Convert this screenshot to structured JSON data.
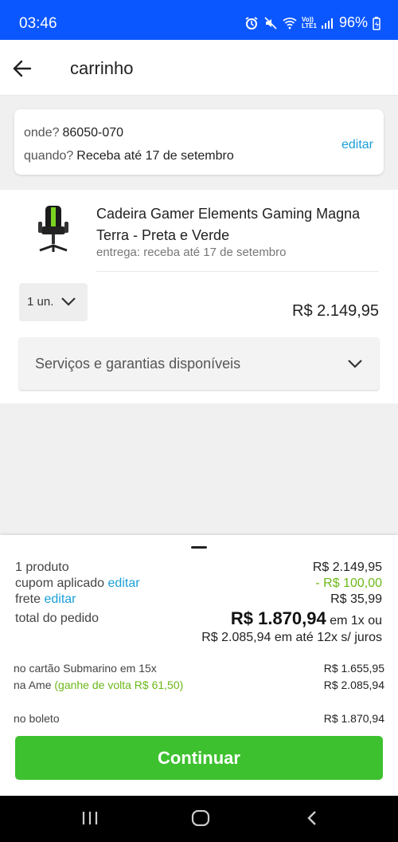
{
  "status_bar": {
    "time": "03:46",
    "volte": "Vo))\nLTE1",
    "battery": "96%"
  },
  "header": {
    "title": "carrinho"
  },
  "delivery": {
    "where_label": "onde?",
    "where_value": "86050-070",
    "when_label": "quando?",
    "when_value": "Receba até 17 de setembro",
    "edit_label": "editar"
  },
  "product": {
    "name": "Cadeira Gamer Elements Gaming Magna Terra - Preta e Verde",
    "delivery": "entrega: receba até 17 de setembro",
    "quantity": "1 un.",
    "price": "R$ 2.149,95",
    "services_label": "Serviços e garantias disponíveis"
  },
  "summary": {
    "products_label": "1 produto",
    "products_value": "R$ 2.149,95",
    "coupon_label": "cupom aplicado",
    "coupon_edit": "editar",
    "coupon_value": "- R$ 100,00",
    "shipping_label": "frete",
    "shipping_edit": "editar",
    "shipping_value": "R$ 35,99",
    "total_label": "total do pedido",
    "total_value": "R$ 1.870,94",
    "total_suffix": "em 1x ou",
    "installments": "R$ 2.085,94 em até 12x s/ juros",
    "card_label": "no cartão Submarino em 15x",
    "card_value": "R$ 1.655,95",
    "ame_label": "na Ame",
    "ame_cashback": "(ganhe de volta R$ 61,50)",
    "ame_value": "R$ 2.085,94",
    "boleto_label": "no boleto",
    "boleto_value": "R$ 1.870,94",
    "continue_label": "Continuar"
  },
  "colors": {
    "status_bar": "#0b57ff",
    "link": "#1a9fd8",
    "discount": "#6cb81a",
    "cta": "#3ec12f"
  }
}
